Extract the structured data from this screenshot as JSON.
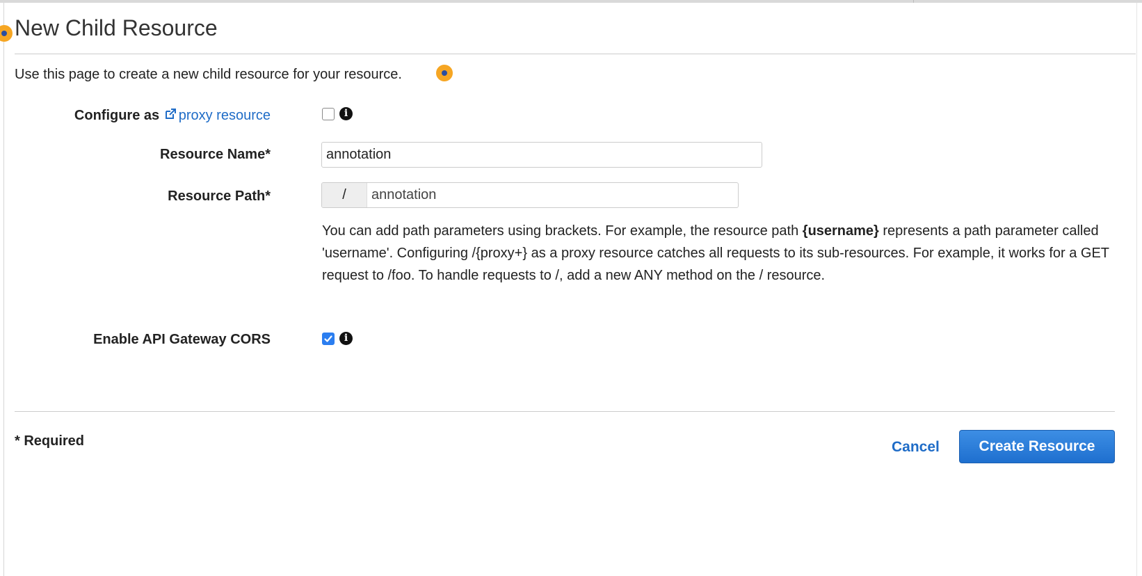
{
  "page": {
    "title": "New Child Resource",
    "intro": "Use this page to create a new child resource for your resource."
  },
  "form": {
    "proxy": {
      "label_prefix": "Configure as",
      "link_text": "proxy resource",
      "checked": false
    },
    "resource_name": {
      "label": "Resource Name*",
      "value": "annotation"
    },
    "resource_path": {
      "label": "Resource Path*",
      "prefix": "/",
      "value": "annotation"
    },
    "help": {
      "part1": "You can add path parameters using brackets. For example, the resource path ",
      "bold": "{username}",
      "part2": " represents a path parameter called 'username'. Configuring /{proxy+} as a proxy resource catches all requests to its sub-resources. For example, it works for a GET request to /foo. To handle requests to /, add a new ANY method on the / resource."
    },
    "cors": {
      "label": "Enable API Gateway CORS",
      "checked": true
    }
  },
  "footer": {
    "required_note": "* Required",
    "cancel_label": "Cancel",
    "create_label": "Create Resource"
  },
  "icons": {
    "info": "info-icon",
    "external_link": "external-link-icon",
    "hotspot": "tour-hotspot-icon"
  },
  "colors": {
    "link": "#1f6cc7",
    "primary_button": "#1e6fcf",
    "hotspot": "#f6a623",
    "checkbox_checked": "#2b7ef0"
  }
}
